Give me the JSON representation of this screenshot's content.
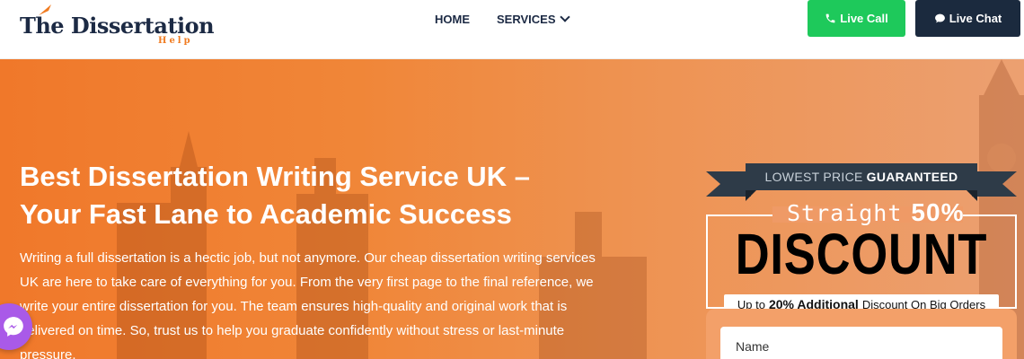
{
  "header": {
    "logo_main": "The Dissertation",
    "logo_sub": "Help",
    "nav": {
      "home": "HOME",
      "services": "SERVICES"
    },
    "live_call": "Live Call",
    "live_chat": "Live Chat"
  },
  "hero": {
    "title_line1": "Best Dissertation Writing Service UK –",
    "title_line2": "Your Fast Lane to Academic Success",
    "paragraph": "Writing a full dissertation is a hectic job, but not anymore. Our cheap dissertation writing services UK are here to take care of everything for you. From the very first page to the final reference, we write your entire dissertation for you. The team ensures high-quality and original work that is delivered on time. So, trust us to help you graduate confidently without stress or last-minute pressure."
  },
  "offer": {
    "ribbon_light": "LOWEST PRICE",
    "ribbon_strong": "GUARANTEED",
    "straight": "Straight",
    "percent": "50%",
    "discount": "DISCOUNT",
    "additional_pre": "Up to",
    "additional_strong": "20% Additional",
    "additional_post": "Discount On Big Orders"
  },
  "form": {
    "name_placeholder": "Name"
  },
  "colors": {
    "brand_orange": "#f07c22",
    "navy": "#1b2a3e",
    "call_green": "#1ec95b",
    "messenger_purple": "#a95ae8"
  },
  "icons": {
    "call": "phone-icon",
    "chat": "chat-bubble-icon",
    "services": "chevron-down-icon",
    "messenger": "messenger-icon"
  }
}
